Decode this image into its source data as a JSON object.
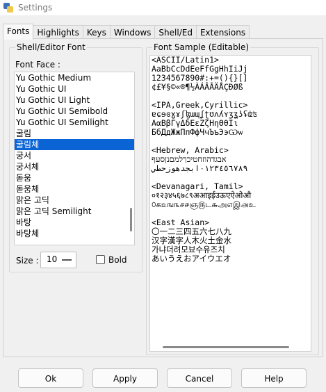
{
  "window": {
    "title": "Settings"
  },
  "tabs": [
    "Fonts",
    "Highlights",
    "Keys",
    "Windows",
    "Shell/Ed",
    "Extensions"
  ],
  "font_group": {
    "title": "Shell/Editor Font",
    "face_label": "Font Face :",
    "fonts": [
      "Yu Gothic Medium",
      "Yu Gothic UI",
      "Yu Gothic UI Light",
      "Yu Gothic UI Semibold",
      "Yu Gothic UI Semilight",
      "굴림",
      "굴림체",
      "궁서",
      "궁서체",
      "돋움",
      "돋움체",
      "맑은 고딕",
      "맑은 고딕 Semilight",
      "바탕",
      "바탕체"
    ],
    "selected_font": "굴림체",
    "size_label": "Size :",
    "size_value": "10",
    "bold_label": "Bold"
  },
  "sample_group": {
    "title": "Font Sample (Editable)",
    "lines": [
      "<ASCII/Latin1>",
      "AaBbCcDdEeFfGgHhIiJj",
      "1234567890#:+=(){}[]",
      "¢£¥§©«®¶½ÀÁÂÃÄÅÇÐØß",
      "",
      "<IPA,Greek,Cyrillic>",
      "ɐɕɘɞɣɤʃɮɯɰʆʈʊʌʎʏʒʓʖʢʣʦ",
      "ΑαΒβΓγΔδΕεΖζΗηΘθΙι",
      "БбДдЖжПпФфЧчЪъЭэѠѡ",
      "",
      "<Hebrew, Arabic>",
      "אבגדהוזחטיכךלמםנןסעף",
      "٠١٢٣٤٥٦٧٨٩ابجدهوزحطي",
      "",
      "<Devanagari, Tamil>",
      "०१२३४५६७८९अआइईउऊएऐओऔ",
      "௦க௨ங௩ச௪ஞ௫ட௬அ௭இ௮உ",
      "",
      "<East Asian>",
      "〇一二三四五六七八九",
      "汉字漢字人木火土金水",
      "가냐더려모뵤수유즈치",
      "あいうえおアイウエオ"
    ]
  },
  "buttons": {
    "ok": "Ok",
    "apply": "Apply",
    "cancel": "Cancel",
    "help": "Help"
  }
}
